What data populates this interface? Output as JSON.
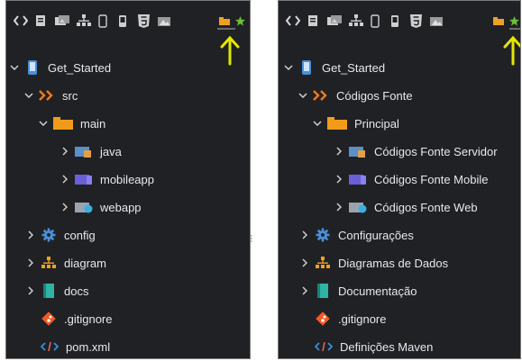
{
  "colors": {
    "panel_bg": "#202124",
    "accent_orange": "#f0a020",
    "accent_green": "#6bbf3a",
    "arrow_yellow": "#e6e600",
    "folder_orange": "#f29a1a",
    "src_orange": "#f07a1a",
    "config_blue": "#4a8fd9",
    "diagram_orange": "#f0a020",
    "docs_teal": "#2eb3a5",
    "xml_blue": "#3a8fd9"
  },
  "left": {
    "toolbar": {
      "icons": [
        "code-brackets-icon",
        "document-icon",
        "photos-icon",
        "sitemap-icon",
        "mobile-outline-icon",
        "mobile-filled-icon",
        "html5-icon",
        "image-icon",
        "folder-tab-icon",
        "star-icon"
      ]
    },
    "tree": {
      "project": "Get_Started",
      "src": "src",
      "main": "main",
      "java": "java",
      "mobileapp": "mobileapp",
      "webapp": "webapp",
      "config": "config",
      "diagram": "diagram",
      "docs": "docs",
      "gitignore": ".gitignore",
      "pom": "pom.xml"
    }
  },
  "right": {
    "toolbar": {
      "icons": [
        "code-brackets-icon",
        "document-icon",
        "photos-icon",
        "sitemap-icon",
        "mobile-outline-icon",
        "mobile-filled-icon",
        "html5-icon",
        "image-icon",
        "folder-tab-icon",
        "star-icon"
      ]
    },
    "tree": {
      "project": "Get_Started",
      "src": "Códigos Fonte",
      "main": "Principal",
      "java": "Códigos Fonte Servidor",
      "mobileapp": "Códigos Fonte Mobile",
      "webapp": "Códigos Fonte Web",
      "config": "Configurações",
      "diagram": "Diagramas de Dados",
      "docs": "Documentação",
      "gitignore": ".gitignore",
      "pom": "Definições Maven"
    }
  }
}
